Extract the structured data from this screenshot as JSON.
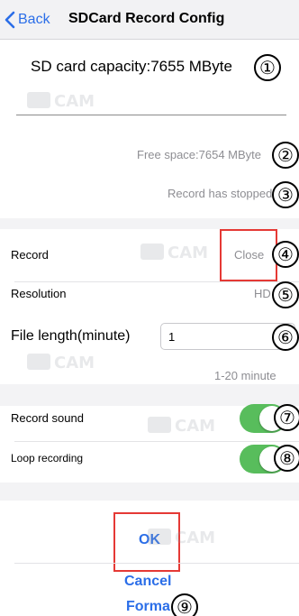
{
  "nav": {
    "back_label": "Back",
    "title": "SDCard Record Config"
  },
  "storage": {
    "capacity_text": "SD card capacity:7655 MByte",
    "free_space_text": "Free space:7654 MByte",
    "record_status_text": "Record has stopped"
  },
  "settings": {
    "record_label": "Record",
    "record_value": "Close",
    "resolution_label": "Resolution",
    "resolution_value": "HD",
    "file_length_label": "File length(minute)",
    "file_length_value": "1",
    "file_length_hint": "1-20 minute",
    "record_sound_label": "Record sound",
    "record_sound_on": true,
    "loop_recording_label": "Loop recording",
    "loop_recording_on": true
  },
  "actions": {
    "ok_label": "OK",
    "cancel_label": "Cancel",
    "format_label": "Forma"
  },
  "callouts": [
    "①",
    "②",
    "③",
    "④",
    "⑤",
    "⑥",
    "⑦",
    "⑧",
    "⑨"
  ],
  "watermark": {
    "brand": "CAM",
    "prefix": "BB"
  },
  "colors": {
    "accent": "#2b6ee8",
    "toggle_on": "#58bd5c",
    "highlight_box": "#e53935",
    "band": "#f3f3f5"
  }
}
